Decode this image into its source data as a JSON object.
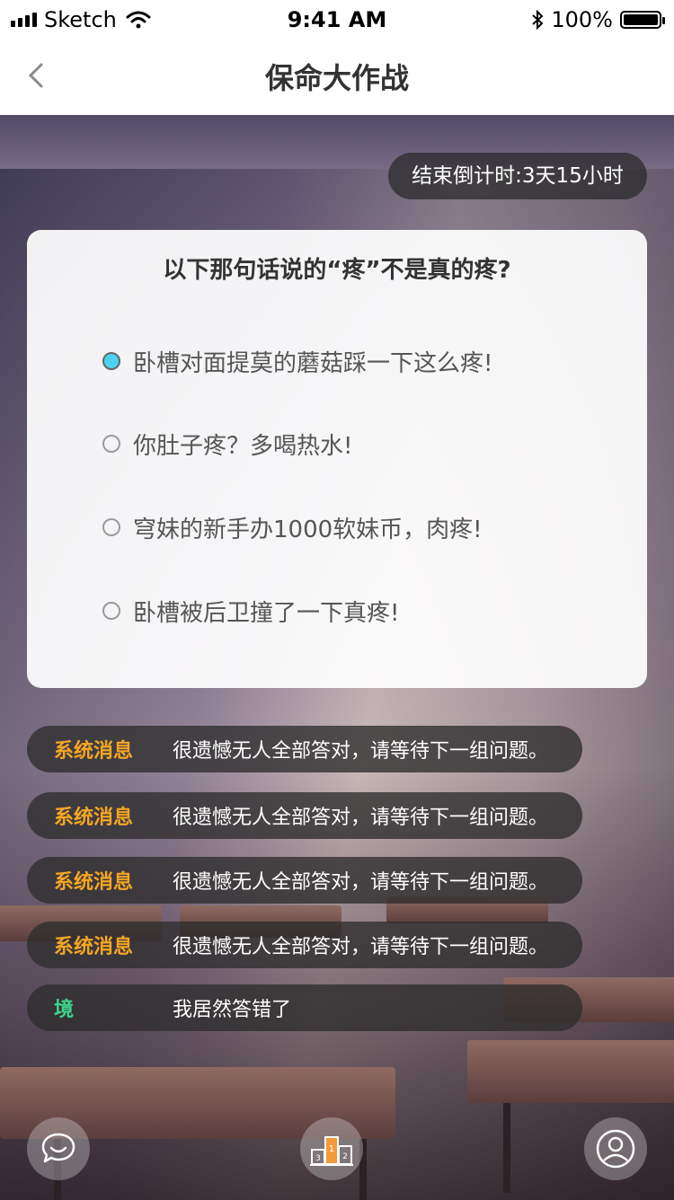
{
  "status_bar": {
    "carrier": "Sketch",
    "time": "9:41 AM",
    "battery": "100%"
  },
  "nav": {
    "title": "保命大作战"
  },
  "timer": {
    "label": "结束倒计时:3天15小时"
  },
  "quiz": {
    "question": "以下那句话说的“疼”不是真的疼?",
    "options": [
      {
        "label": "卧槽对面提莫的蘑菇踩一下这么疼!",
        "selected": true
      },
      {
        "label": "你肚子疼？多喝热水!",
        "selected": false
      },
      {
        "label": "穹妹的新手办1000软妹币，肉疼!",
        "selected": false
      },
      {
        "label": "卧槽被后卫撞了一下真疼!",
        "selected": false
      }
    ]
  },
  "messages": [
    {
      "sender": "系统消息",
      "text": "很遗憾无人全部答对，请等待下一组问题。"
    },
    {
      "sender": "系统消息",
      "text": "很遗憾无人全部答对，请等待下一组问题。"
    },
    {
      "sender": "系统消息",
      "text": "很遗憾无人全部答对，请等待下一组问题。"
    },
    {
      "sender": "系统消息",
      "text": "很遗憾无人全部答对，请等待下一组问题。"
    },
    {
      "sender": "境",
      "text": "我居然答错了"
    }
  ],
  "bottom_actions": [
    {
      "icon": "chat-bubble-icon"
    },
    {
      "icon": "podium-ranking-icon",
      "ranks": [
        "3",
        "1",
        "2"
      ]
    },
    {
      "icon": "user-profile-icon"
    }
  ],
  "colors": {
    "system_sender": "#f5a623",
    "user_sender": "#3ed48a",
    "selected_radio": "#4dd3f2"
  }
}
